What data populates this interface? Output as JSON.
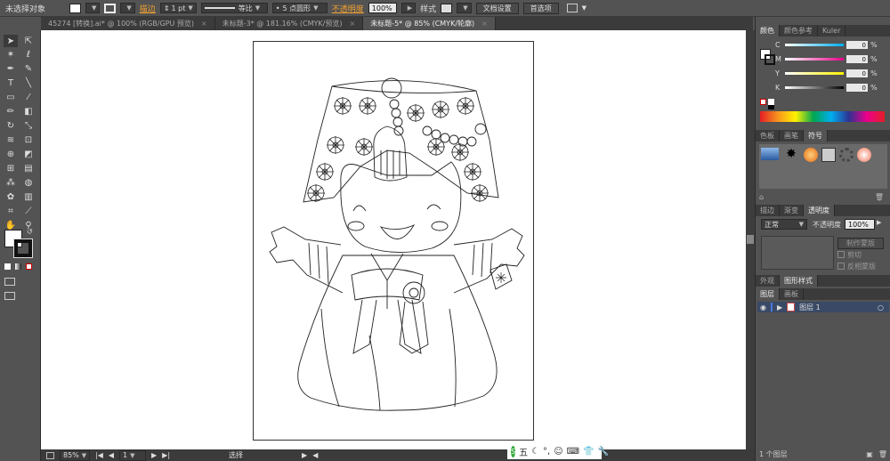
{
  "control_bar": {
    "selection_label": "未选择对象",
    "stroke_label": "描边",
    "stroke_weight": "1 pt",
    "stroke_profile": "等比",
    "brush": "5 点圆形",
    "opacity_label": "不透明度",
    "opacity_value": "100%",
    "style_label": "样式",
    "doc_setup_button": "文档设置",
    "prefs_button": "首选项"
  },
  "tabs": [
    {
      "label": "45274 [转换].ai* @ 100% (RGB/GPU 预览)",
      "active": false
    },
    {
      "label": "未标题-3* @ 181.16% (CMYK/预览)",
      "active": false
    },
    {
      "label": "未标题-5* @ 85% (CMYK/轮廓)",
      "active": true
    }
  ],
  "status_bar": {
    "zoom": "85%",
    "artboard": "1",
    "tool_status": "选择"
  },
  "ime": {
    "label": "五"
  },
  "color_panel": {
    "tabs": [
      "颜色",
      "颜色参考",
      "Kuler"
    ],
    "channels": [
      {
        "label": "C",
        "value": "0",
        "unit": "%"
      },
      {
        "label": "M",
        "value": "0",
        "unit": "%"
      },
      {
        "label": "Y",
        "value": "0",
        "unit": "%"
      },
      {
        "label": "K",
        "value": "0",
        "unit": "%"
      }
    ]
  },
  "swatches_panel": {
    "tabs": [
      "色板",
      "画笔",
      "符号"
    ]
  },
  "transparency_panel": {
    "tabs": [
      "描边",
      "渐变",
      "透明度"
    ],
    "blend_mode": "正常",
    "opacity_label": "不透明度",
    "opacity_value": "100%",
    "make_mask_button": "制作蒙版",
    "clip_label": "剪切",
    "invert_label": "反相蒙版"
  },
  "appearance_panel": {
    "tabs": [
      "外观",
      "图形样式"
    ]
  },
  "layers_panel": {
    "tabs": [
      "图层",
      "画板"
    ],
    "layer_name": "图层 1",
    "footer_label": "1 个图层"
  }
}
